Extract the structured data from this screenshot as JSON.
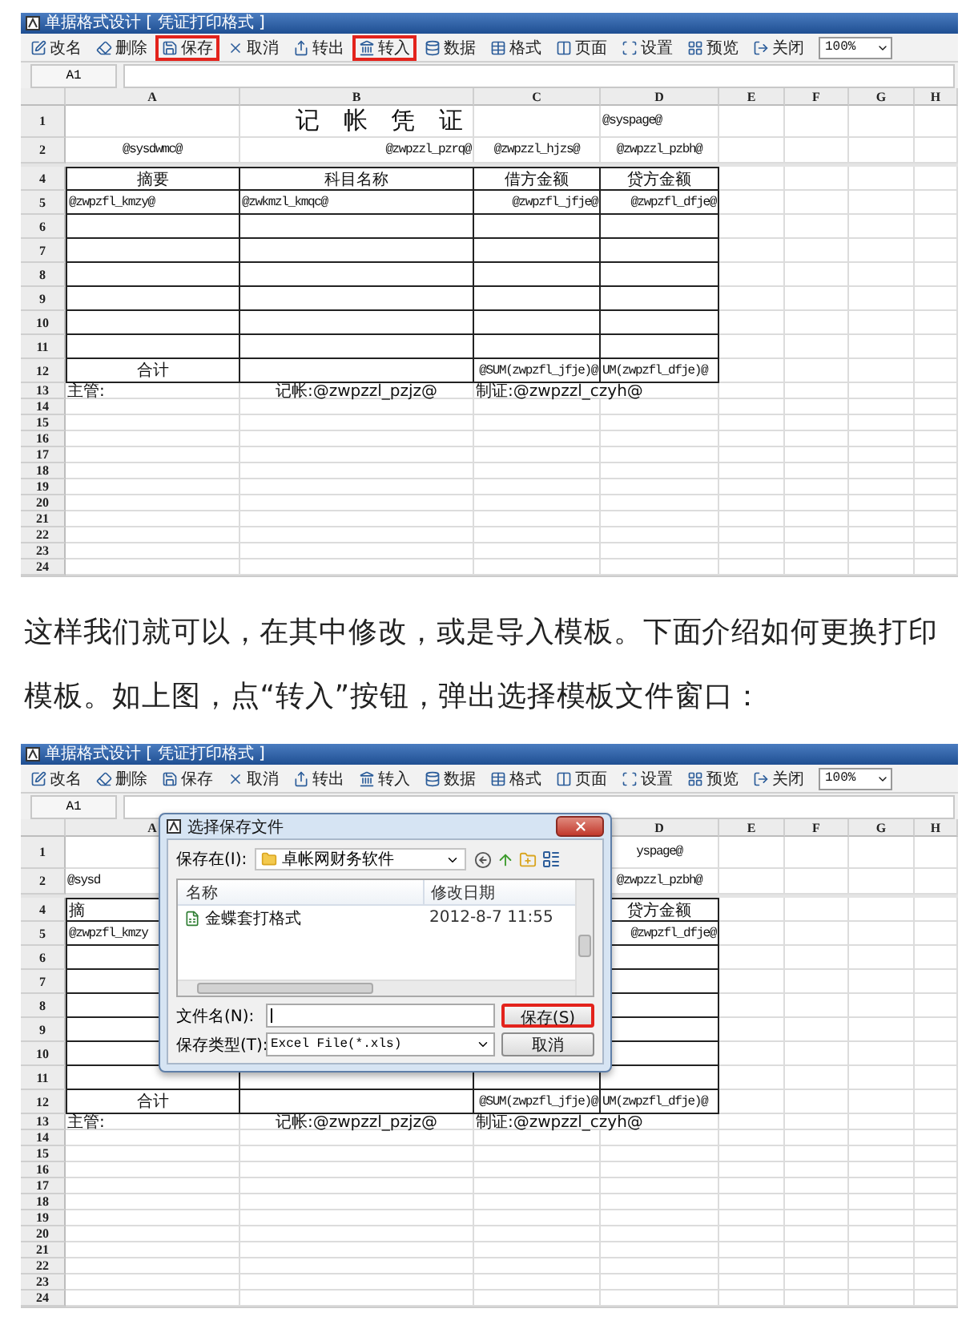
{
  "screenshots": [
    {
      "window": {
        "title": "单据格式设计 [ 凭证打印格式 ]"
      },
      "toolbar": [
        {
          "label": "改名",
          "highlighted": false
        },
        {
          "label": "删除",
          "highlighted": false
        },
        {
          "label": "保存",
          "highlighted": true
        },
        {
          "label": "取消",
          "highlighted": false
        },
        {
          "label": "转出",
          "highlighted": false
        },
        {
          "label": "转入",
          "highlighted": true
        },
        {
          "label": "数据",
          "highlighted": false
        },
        {
          "label": "格式",
          "highlighted": false
        },
        {
          "label": "页面",
          "highlighted": false
        },
        {
          "label": "设置",
          "highlighted": false
        },
        {
          "label": "预览",
          "highlighted": false
        },
        {
          "label": "关闭",
          "highlighted": false
        }
      ],
      "zoom": "100%",
      "name_box": "A1",
      "column_headers": {
        "A": "A",
        "B": "B",
        "C": "C",
        "D": "D",
        "E": "E",
        "F": "F",
        "G": "G",
        "H": "H"
      },
      "rows": [
        {
          "number": "1",
          "boxed": false,
          "cells": {
            "B": {
              "text": "记 帐 凭 证",
              "kind": "title"
            },
            "D": {
              "text": "@syspage@",
              "kind": "left"
            }
          }
        },
        {
          "number": "2",
          "boxed": false,
          "cells": {
            "A": {
              "text": "@sysdwmc@",
              "kind": "center"
            },
            "B": {
              "text": "@zwpzzl_pzrq@",
              "kind": "right"
            },
            "C": {
              "text": "@zwpzzl_hjzs@",
              "kind": "center"
            },
            "D": {
              "text": "@zwpzzl_pzbh@",
              "kind": "center"
            }
          }
        },
        {
          "number": "4",
          "boxed": true,
          "cells": {
            "A": {
              "text": "摘要",
              "kind": "label"
            },
            "B": {
              "text": "科目名称",
              "kind": "label"
            },
            "C": {
              "text": "借方金额",
              "kind": "label"
            },
            "D": {
              "text": "贷方金额",
              "kind": "label"
            }
          }
        },
        {
          "number": "5",
          "boxed": true,
          "cells": {
            "A": {
              "text": "@zwpzfl_kmzy@",
              "kind": "left"
            },
            "B": {
              "text": "@zwkmzl_kmqc@",
              "kind": "left"
            },
            "C": {
              "text": "@zwpzfl_jfje@",
              "kind": "right"
            },
            "D": {
              "text": "@zwpzfl_dfje@",
              "kind": "right"
            }
          }
        },
        {
          "number": "6",
          "boxed": true
        },
        {
          "number": "7",
          "boxed": true
        },
        {
          "number": "8",
          "boxed": true
        },
        {
          "number": "9",
          "boxed": true
        },
        {
          "number": "10",
          "boxed": true
        },
        {
          "number": "11",
          "boxed": true
        },
        {
          "number": "12",
          "boxed": true,
          "cells": {
            "A": {
              "text": "合计",
              "kind": "label"
            },
            "C": {
              "text": "@SUM(zwpzfl_jfje)@",
              "kind": "right"
            },
            "D": {
              "text": "UM(zwpzfl_dfje)@",
              "kind": "left"
            }
          }
        },
        {
          "number": "13",
          "boxed": false,
          "cells": {
            "A": {
              "text": "主管:",
              "kind": "note"
            },
            "B": {
              "text": "记帐:@zwpzzl_pzjz@",
              "kind": "label"
            },
            "C": {
              "text": "制证:@zwpzzl_czyh@",
              "kind": "wide"
            }
          }
        },
        {
          "number": "14",
          "boxed": false
        },
        {
          "number": "15",
          "boxed": false
        },
        {
          "number": "16",
          "boxed": false
        },
        {
          "number": "17",
          "boxed": false
        },
        {
          "number": "18",
          "boxed": false
        },
        {
          "number": "19",
          "boxed": false
        },
        {
          "number": "20",
          "boxed": false
        },
        {
          "number": "21",
          "boxed": false
        },
        {
          "number": "22",
          "boxed": false
        },
        {
          "number": "23",
          "boxed": false
        },
        {
          "number": "24",
          "boxed": false
        }
      ]
    },
    {
      "window": {
        "title": "单据格式设计 [ 凭证打印格式 ]"
      },
      "toolbar": [
        {
          "label": "改名",
          "highlighted": false
        },
        {
          "label": "删除",
          "highlighted": false
        },
        {
          "label": "保存",
          "highlighted": false
        },
        {
          "label": "取消",
          "highlighted": false
        },
        {
          "label": "转出",
          "highlighted": false
        },
        {
          "label": "转入",
          "highlighted": false
        },
        {
          "label": "数据",
          "highlighted": false
        },
        {
          "label": "格式",
          "highlighted": false
        },
        {
          "label": "页面",
          "highlighted": false
        },
        {
          "label": "设置",
          "highlighted": false
        },
        {
          "label": "预览",
          "highlighted": false
        },
        {
          "label": "关闭",
          "highlighted": false
        }
      ],
      "zoom": "100%",
      "name_box": "A1",
      "column_headers": {
        "A": "A",
        "D": "D",
        "E": "E",
        "F": "F",
        "G": "G",
        "H": "H"
      },
      "rows": [
        {
          "number": "1",
          "boxed": false,
          "cells": {
            "D": {
              "text": "yspage@",
              "kind": "center"
            }
          }
        },
        {
          "number": "2",
          "boxed": false,
          "cells": {
            "A": {
              "text": "@sysd",
              "kind": "left"
            },
            "D": {
              "text": "@zwpzzl_pzbh@",
              "kind": "center"
            }
          }
        },
        {
          "number": "4",
          "boxed": true,
          "cells": {
            "A": {
              "text": "摘",
              "kind": "note"
            },
            "D": {
              "text": "贷方金额",
              "kind": "label"
            }
          }
        },
        {
          "number": "5",
          "boxed": true,
          "cells": {
            "A": {
              "text": "@zwpzfl_kmzy",
              "kind": "left"
            },
            "D": {
              "text": "@zwpzfl_dfje@",
              "kind": "right"
            }
          }
        },
        {
          "number": "6",
          "boxed": true
        },
        {
          "number": "7",
          "boxed": true
        },
        {
          "number": "8",
          "boxed": true
        },
        {
          "number": "9",
          "boxed": true
        },
        {
          "number": "10",
          "boxed": true
        },
        {
          "number": "11",
          "boxed": true
        },
        {
          "number": "12",
          "boxed": true,
          "cells": {
            "A": {
              "text": "合计",
              "kind": "label"
            },
            "C": {
              "text": "@SUM(zwpzfl_jfje)@",
              "kind": "right"
            },
            "D": {
              "text": "UM(zwpzfl_dfje)@",
              "kind": "left"
            }
          }
        },
        {
          "number": "13",
          "boxed": false,
          "cells": {
            "A": {
              "text": "主管:",
              "kind": "note"
            },
            "B": {
              "text": "记帐:@zwpzzl_pzjz@",
              "kind": "label"
            },
            "C": {
              "text": "制证:@zwpzzl_czyh@",
              "kind": "wide"
            }
          }
        },
        {
          "number": "14",
          "boxed": false
        },
        {
          "number": "15",
          "boxed": false
        },
        {
          "number": "16",
          "boxed": false
        },
        {
          "number": "17",
          "boxed": false
        },
        {
          "number": "18",
          "boxed": false
        },
        {
          "number": "19",
          "boxed": false
        },
        {
          "number": "20",
          "boxed": false
        },
        {
          "number": "21",
          "boxed": false
        },
        {
          "number": "22",
          "boxed": false
        },
        {
          "number": "23",
          "boxed": false
        },
        {
          "number": "24",
          "boxed": false
        }
      ],
      "dialog": {
        "title": "选择保存文件",
        "location_label": "保存在(I):",
        "location": "卓帐网财务软件",
        "columns": [
          "名称",
          "修改日期"
        ],
        "files": [
          {
            "name": "金蝶套打格式",
            "modified": "2012-8-7 11:55"
          }
        ],
        "file_name_label": "文件名(N):",
        "file_type_label": "保存类型(T):",
        "file_type": "Excel File(*.xls)",
        "buttons": [
          {
            "label": "保存(S)",
            "highlighted": true
          },
          {
            "label": "取消",
            "highlighted": false
          }
        ]
      }
    }
  ],
  "paragraph": "这样我们就可以，在其中修改，或是导入模板。下面介绍如何更换打印模板。如上图，点“转入”按钮，弹出选择模板文件窗口："
}
